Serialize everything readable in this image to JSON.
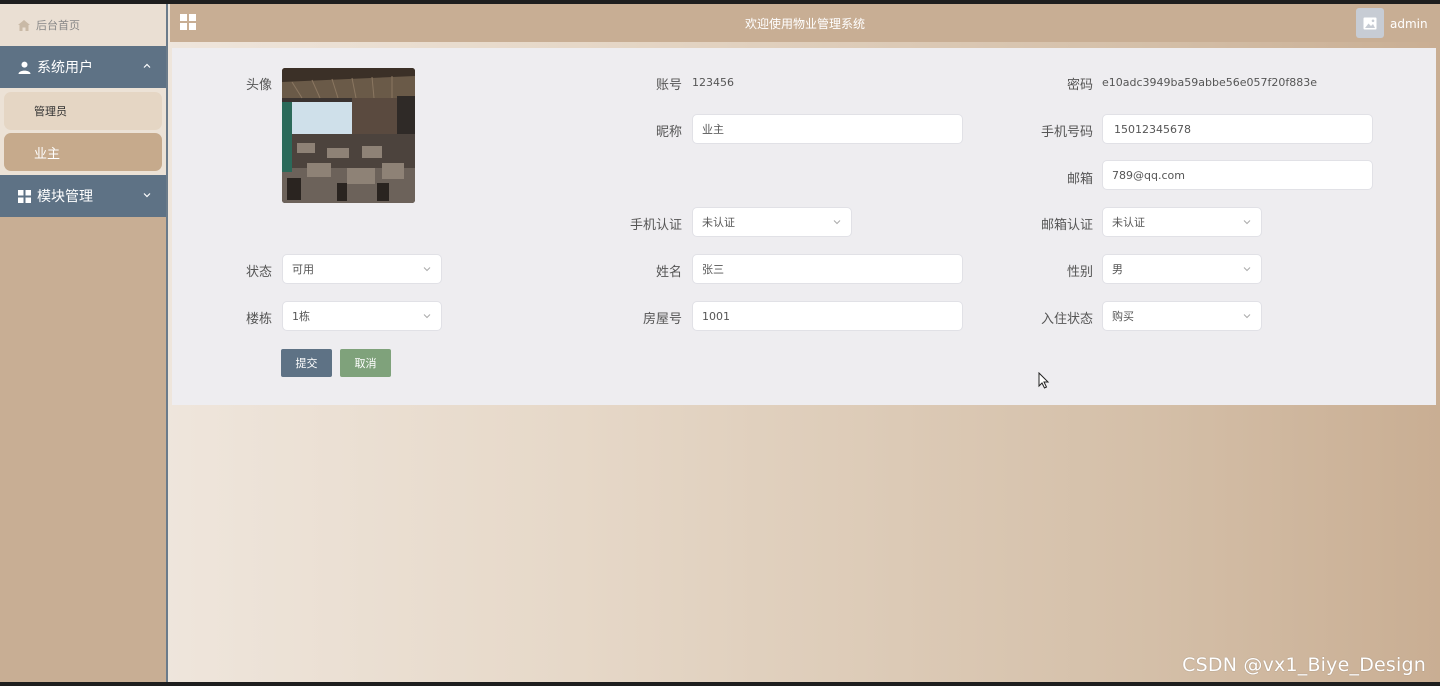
{
  "sidebar": {
    "home_label": "后台首页",
    "groups": [
      {
        "label": "系统用户",
        "items": [
          {
            "label": "管理员"
          },
          {
            "label": "业主"
          }
        ]
      },
      {
        "label": "模块管理"
      }
    ]
  },
  "header": {
    "title": "欢迎使用物业管理系统",
    "username": "admin"
  },
  "form": {
    "avatar_label": "头像",
    "account_label": "账号",
    "account_value": "123456",
    "password_label": "密码",
    "password_value": "e10adc3949ba59abbe56e057f20f883e",
    "nickname_label": "昵称",
    "nickname_value": "业主",
    "phone_label": "手机号码",
    "phone_value": "15012345678",
    "email_label": "邮箱",
    "email_value": "789@qq.com",
    "phone_verify_label": "手机认证",
    "phone_verify_value": "未认证",
    "email_verify_label": "邮箱认证",
    "email_verify_value": "未认证",
    "status_label": "状态",
    "status_value": "可用",
    "name_label": "姓名",
    "name_value": "张三",
    "gender_label": "性别",
    "gender_value": "男",
    "building_label": "楼栋",
    "building_value": "1栋",
    "room_label": "房屋号",
    "room_value": "1001",
    "checkin_label": "入住状态",
    "checkin_value": "购买",
    "submit_label": "提交",
    "cancel_label": "取消"
  },
  "watermark": "CSDN @vx1_Biye_Design",
  "colors": {
    "sidebar_group": "#5e7285",
    "accent": "#c8ae94",
    "submit": "#5e7285",
    "cancel": "#7fa27b"
  }
}
